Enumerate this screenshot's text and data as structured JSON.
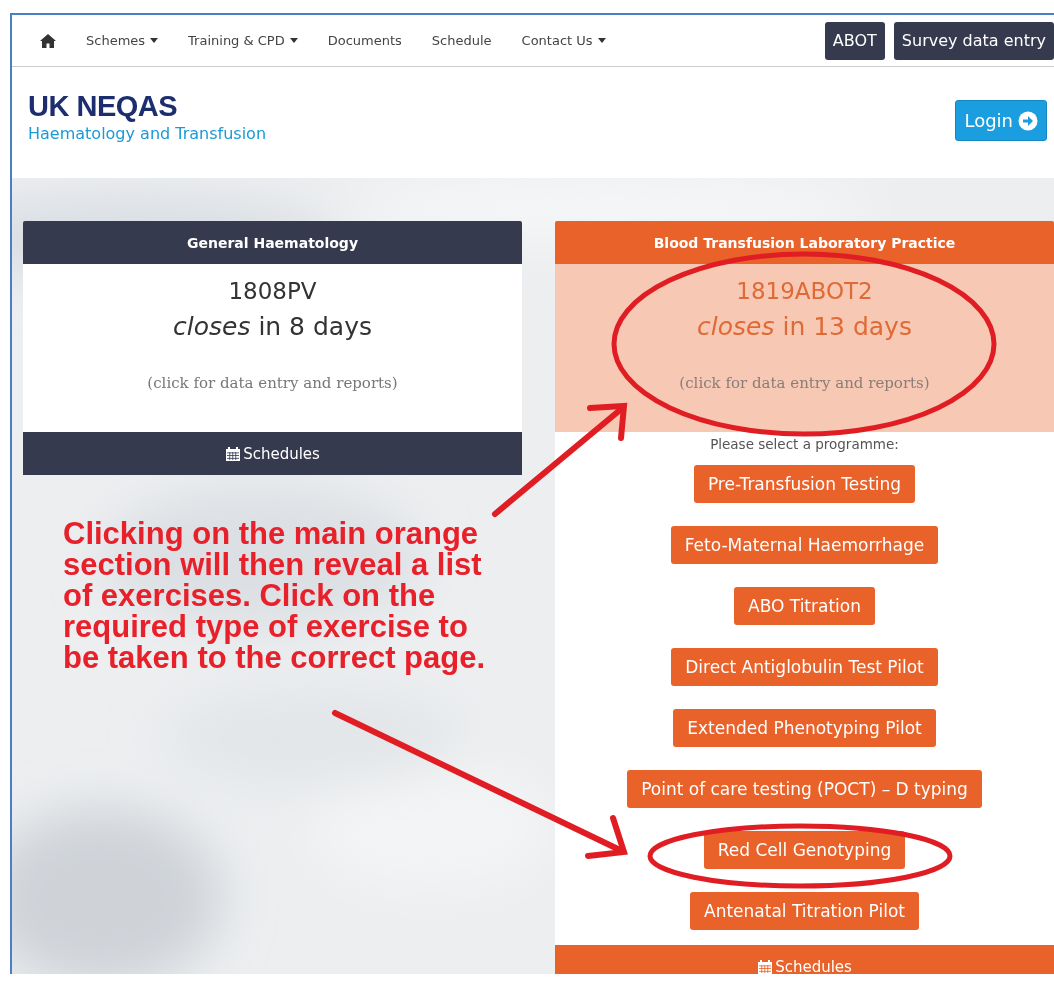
{
  "nav": {
    "items": [
      {
        "kind": "home"
      },
      {
        "kind": "dropdown",
        "label": "Schemes"
      },
      {
        "kind": "dropdown",
        "label": "Training & CPD"
      },
      {
        "kind": "link",
        "label": "Documents"
      },
      {
        "kind": "link",
        "label": "Schedule"
      },
      {
        "kind": "dropdown",
        "label": "Contact Us"
      }
    ],
    "buttons": [
      "ABOT",
      "Survey data entry"
    ]
  },
  "header": {
    "logo": "UK NEQAS",
    "subtitle": "Haematology and Transfusion",
    "login": "Login"
  },
  "cards": [
    {
      "kind": "dark",
      "title": "General Haematology",
      "code": "1808PV",
      "closes": "*closes* in 8 days",
      "hint": "(click for data entry and reports)",
      "footer": "Schedules"
    },
    {
      "kind": "orange",
      "title": "Blood Transfusion Laboratory Practice",
      "code": "1819ABOT2",
      "closes": "*closes* in 13 days",
      "hint": "(click for data entry and reports)",
      "prompt": "Please select a programme:",
      "programmes": [
        "Pre-Transfusion Testing",
        "Feto-Maternal Haemorrhage",
        "ABO Titration",
        "Direct Antiglobulin Test Pilot",
        "Extended Phenotyping Pilot",
        "Point of care testing (POCT) – D typing",
        "Red Cell Genotyping",
        "Antenatal Titration Pilot"
      ],
      "footer": "Schedules"
    }
  ],
  "annotation": {
    "text": "Clicking on the main orange section will then reveal a list of exercises. Click on the required type of exercise to be taken to the correct page."
  }
}
